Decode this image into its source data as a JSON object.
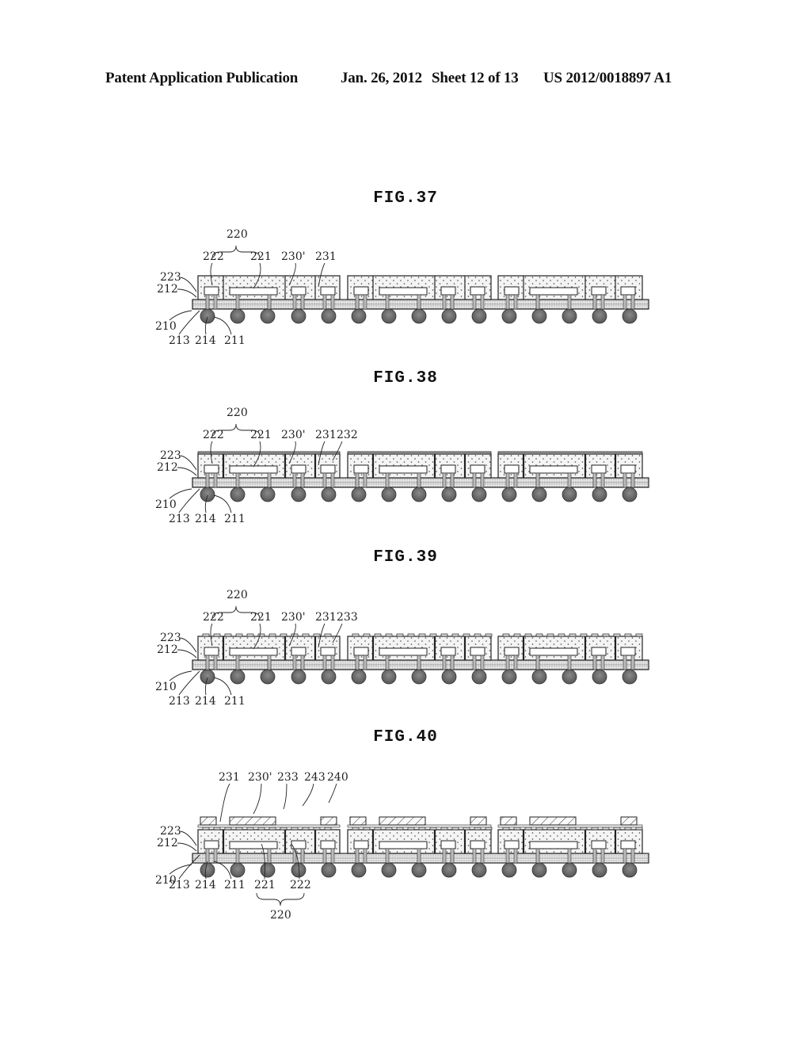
{
  "header": {
    "publication": "Patent Application Publication",
    "date": "Jan. 26, 2012",
    "sheet": "Sheet 12 of 13",
    "number": "US 2012/0018897 A1"
  },
  "figures": [
    {
      "id": "fig37",
      "title": "FIG.37",
      "variant": "base",
      "labels_top": [
        "222",
        "221",
        "230'",
        "231"
      ],
      "brace_label": "220",
      "labels_left": [
        "223",
        "212",
        "210"
      ],
      "labels_bottom": [
        "213",
        "214",
        "211"
      ]
    },
    {
      "id": "fig38",
      "title": "FIG.38",
      "variant": "layer232",
      "labels_top": [
        "222",
        "221",
        "230'",
        "231",
        "232"
      ],
      "brace_label": "220",
      "labels_left": [
        "223",
        "212",
        "210"
      ],
      "labels_bottom": [
        "213",
        "214",
        "211"
      ]
    },
    {
      "id": "fig39",
      "title": "FIG.39",
      "variant": "pads233",
      "labels_top": [
        "222",
        "221",
        "230'",
        "231",
        "233"
      ],
      "brace_label": "220",
      "labels_left": [
        "223",
        "212",
        "210"
      ],
      "labels_bottom": [
        "213",
        "214",
        "211"
      ]
    },
    {
      "id": "fig40",
      "title": "FIG.40",
      "variant": "components240",
      "labels_top": [
        "231",
        "230'",
        "233",
        "243",
        "240"
      ],
      "brace_label": "220",
      "labels_left": [
        "223",
        "212",
        "210"
      ],
      "labels_bottom": [
        "213",
        "214",
        "211",
        "221",
        "222"
      ]
    }
  ],
  "colors": {
    "ink": "#222222",
    "ball": "#6b6b6b",
    "mold": "#f4f4f4",
    "substrate": "#e6e6e6"
  }
}
